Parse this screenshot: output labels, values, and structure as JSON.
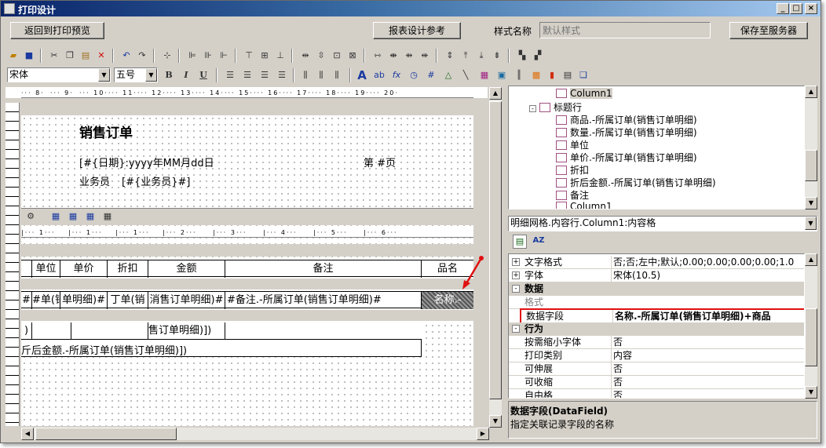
{
  "window": {
    "title": "打印设计"
  },
  "topbar": {
    "back_button": "返回到打印预览",
    "reference_button": "报表设计参考",
    "style_label": "样式名称",
    "style_placeholder": "默认样式",
    "save_button": "保存至服务器"
  },
  "toolbar2": {
    "font_name": "宋体",
    "font_size": "五号",
    "bold": "B",
    "italic": "I",
    "underline": "U"
  },
  "report": {
    "title": "销售订单",
    "date_field": "[#{日期}:yyyy年MM月dd日",
    "page_field": "第  #页",
    "salesman_label": "业务员",
    "salesman_field": "[#{业务员}#]",
    "columns": [
      "单位",
      "单价",
      "折扣",
      "金额",
      "备注",
      "品名"
    ],
    "content_cells": [
      "#单(销",
      "单明细)#",
      "丁单(销",
      "消售订单明细)#",
      "#备注.-所属订单(销售订单明细)#",
      "名称.-"
    ],
    "footer_cell": "售订单明细)])",
    "footer_left": ")",
    "footer_total": "斤后金额.-所属订单(销售订单明细)])"
  },
  "ruler": {
    "top_marks": [
      "8",
      "9",
      "10",
      "11",
      "12",
      "13",
      "14",
      "15",
      "16",
      "17",
      "18",
      "19",
      "20"
    ],
    "mid_marks": [
      "1",
      "1",
      "1",
      "2",
      "3",
      "4",
      "5",
      "6"
    ]
  },
  "tree": {
    "items": [
      {
        "label": "Column1",
        "level": 3,
        "selected": true
      },
      {
        "label": "标题行",
        "level": 2
      },
      {
        "label": "商品.-所属订单(销售订单明细)",
        "level": 3
      },
      {
        "label": "数量.-所属订单(销售订单明细)",
        "level": 3
      },
      {
        "label": "单位",
        "level": 3
      },
      {
        "label": "单价.-所属订单(销售订单明细)",
        "level": 3
      },
      {
        "label": "折扣",
        "level": 3
      },
      {
        "label": "折后金额.-所属订单(销售订单明细)",
        "level": 3
      },
      {
        "label": "备注",
        "level": 3
      },
      {
        "label": "Column1",
        "level": 3
      }
    ]
  },
  "object_selector": {
    "value": "明细网格.内容行.Column1:内容格"
  },
  "properties": {
    "rows": [
      {
        "type": "prop",
        "name": "文字格式",
        "value": "否;否;左中;默认;0.00;0.00;0.00;0.00;1.0",
        "expander": "+"
      },
      {
        "type": "prop",
        "name": "字体",
        "value": "宋体(10.5)",
        "expander": "+"
      },
      {
        "type": "cat",
        "name": "数据",
        "expander": "-"
      },
      {
        "type": "prop",
        "name": "格式",
        "value": "",
        "disabled": true
      },
      {
        "type": "prop",
        "name": "数据字段",
        "value": "名称.-所属订单(销售订单明细)+商品",
        "highlight": true
      },
      {
        "type": "cat",
        "name": "行为",
        "expander": "-"
      },
      {
        "type": "prop",
        "name": "按需缩小字体",
        "value": "否"
      },
      {
        "type": "prop",
        "name": "打印类别",
        "value": "内容"
      },
      {
        "type": "prop",
        "name": "可伸展",
        "value": "否"
      },
      {
        "type": "prop",
        "name": "可收缩",
        "value": "否"
      },
      {
        "type": "prop",
        "name": "自由格",
        "value": "否"
      }
    ]
  },
  "description": {
    "title": "数据字段(DataField)",
    "text": "指定关联记录字段的名称"
  },
  "colors": {
    "highlight_border": "#e01010",
    "arrow": "#e01010",
    "title_start": "#0a246a",
    "title_end": "#a6caf0"
  }
}
